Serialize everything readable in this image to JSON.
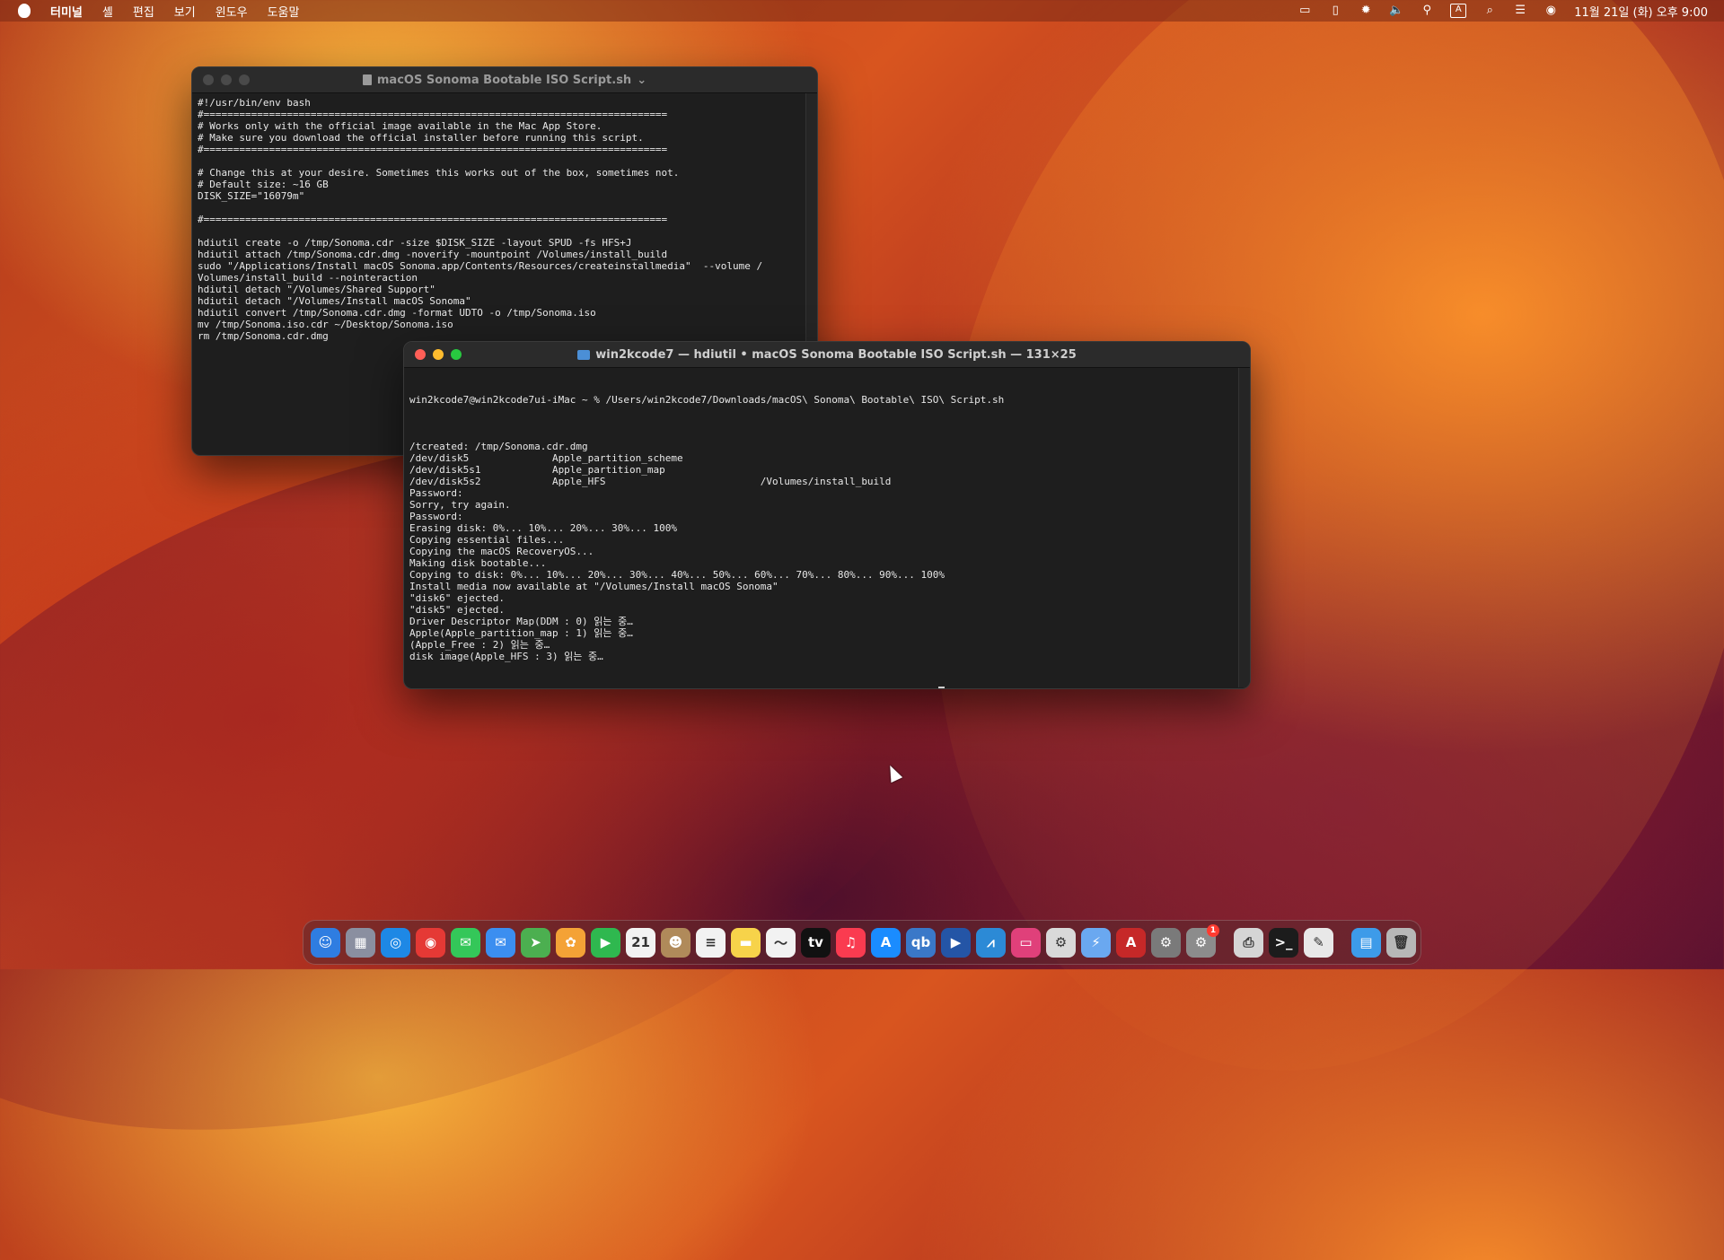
{
  "menubar": {
    "app_name": "터미널",
    "items": [
      "셸",
      "편집",
      "보기",
      "윈도우",
      "도움말"
    ],
    "datetime": "11월 21일 (화) 오후 9:00",
    "input_source": "A"
  },
  "editor_window": {
    "title": "macOS Sonoma Bootable ISO Script.sh",
    "title_chevron": "⌄",
    "lines": [
      "#!/usr/bin/env bash",
      "#==============================================================================",
      "# Works only with the official image available in the Mac App Store.",
      "# Make sure you download the official installer before running this script.",
      "#==============================================================================",
      "",
      "# Change this at your desire. Sometimes this works out of the box, sometimes not.",
      "# Default size: ~16 GB",
      "DISK_SIZE=\"16079m\"",
      "",
      "#==============================================================================",
      "",
      "hdiutil create -o /tmp/Sonoma.cdr -size $DISK_SIZE -layout SPUD -fs HFS+J",
      "hdiutil attach /tmp/Sonoma.cdr.dmg -noverify -mountpoint /Volumes/install_build",
      "sudo \"/Applications/Install macOS Sonoma.app/Contents/Resources/createinstallmedia\"  --volume /",
      "Volumes/install_build --nointeraction",
      "hdiutil detach \"/Volumes/Shared Support\"",
      "hdiutil detach \"/Volumes/Install macOS Sonoma\"",
      "hdiutil convert /tmp/Sonoma.cdr.dmg -format UDTO -o /tmp/Sonoma.iso",
      "mv /tmp/Sonoma.iso.cdr ~/Desktop/Sonoma.iso",
      "rm /tmp/Sonoma.cdr.dmg"
    ]
  },
  "terminal_window": {
    "title": "win2kcode7 — hdiutil • macOS Sonoma Bootable ISO Script.sh — 131×25",
    "prompt_line": "win2kcode7@win2kcode7ui-iMac ~ % /Users/win2kcode7/Downloads/macOS\\ Sonoma\\ Bootable\\ ISO\\ Script.sh",
    "output_lines": [
      "",
      "/tcreated: /tmp/Sonoma.cdr.dmg",
      "/dev/disk5              Apple_partition_scheme",
      "/dev/disk5s1            Apple_partition_map",
      "/dev/disk5s2            Apple_HFS                          /Volumes/install_build",
      "Password:",
      "Sorry, try again.",
      "Password:",
      "Erasing disk: 0%... 10%... 20%... 30%... 100%",
      "Copying essential files...",
      "Copying the macOS RecoveryOS...",
      "Making disk bootable...",
      "Copying to disk: 0%... 10%... 20%... 30%... 40%... 50%... 60%... 70%... 80%... 90%... 100%",
      "Install media now available at \"/Volumes/Install macOS Sonoma\"",
      "\"disk6\" ejected.",
      "\"disk5\" ejected.",
      "Driver Descriptor Map(DDM : 0) 읽는 중…",
      "Apple(Apple_partition_map : 1) 읽는 중…",
      "(Apple_Free : 2) 읽는 중…",
      "disk image(Apple_HFS : 3) 읽는 중…"
    ],
    "progress_line": "........................................................................................."
  },
  "dock": {
    "items": [
      {
        "name": "finder",
        "glyph": "☺",
        "color": "#2f7de1"
      },
      {
        "name": "launchpad",
        "glyph": "▦",
        "color": "#8a8fa0"
      },
      {
        "name": "safari",
        "glyph": "◎",
        "color": "#1e88e5"
      },
      {
        "name": "chrome",
        "glyph": "◉",
        "color": "#e53935"
      },
      {
        "name": "messages",
        "glyph": "✉",
        "color": "#34c759"
      },
      {
        "name": "mail",
        "glyph": "✉",
        "color": "#3b8ef0"
      },
      {
        "name": "maps",
        "glyph": "➤",
        "color": "#4caf50"
      },
      {
        "name": "photos",
        "glyph": "✿",
        "color": "#f4a236"
      },
      {
        "name": "facetime",
        "glyph": "▶",
        "color": "#2fb84f"
      },
      {
        "name": "calendar",
        "glyph": "21",
        "color": "#f2f2f2"
      },
      {
        "name": "contacts",
        "glyph": "☻",
        "color": "#b08a5a"
      },
      {
        "name": "reminders",
        "glyph": "≡",
        "color": "#f2f2f2"
      },
      {
        "name": "notes",
        "glyph": "▬",
        "color": "#f7d34a"
      },
      {
        "name": "freeform",
        "glyph": "〜",
        "color": "#f2f2f2"
      },
      {
        "name": "apple-tv",
        "glyph": "tv",
        "color": "#111111"
      },
      {
        "name": "music",
        "glyph": "♫",
        "color": "#fa3b50"
      },
      {
        "name": "app-store",
        "glyph": "A",
        "color": "#1a8cff"
      },
      {
        "name": "qbittorrent",
        "glyph": "qb",
        "color": "#3a78c8"
      },
      {
        "name": "remote-desktop",
        "glyph": "▶",
        "color": "#2455a6"
      },
      {
        "name": "activity-monitor",
        "glyph": "⩘",
        "color": "#2c8ad6"
      },
      {
        "name": "cleanmymac",
        "glyph": "▭",
        "color": "#e0407a"
      },
      {
        "name": "disk-utility",
        "glyph": "⚙",
        "color": "#d9d9d9"
      },
      {
        "name": "shortcuts",
        "glyph": "⚡",
        "color": "#6aa8f0"
      },
      {
        "name": "acrobat",
        "glyph": "A",
        "color": "#c62828"
      },
      {
        "name": "system-settings",
        "glyph": "⚙",
        "color": "#7a7a7a"
      },
      {
        "name": "settings-badge",
        "glyph": "⚙",
        "color": "#8c8c8c",
        "badge": "1"
      },
      {
        "name": "printer",
        "glyph": "⎙",
        "color": "#d5d5d5"
      },
      {
        "name": "terminal",
        "glyph": ">_",
        "color": "#1c1c1c"
      },
      {
        "name": "script-editor",
        "glyph": "✎",
        "color": "#e8e8e8"
      },
      {
        "name": "downloads-folder",
        "glyph": "▤",
        "color": "#3d9be9"
      },
      {
        "name": "trash",
        "glyph": "🗑",
        "color": "#b7b7b7"
      }
    ]
  }
}
